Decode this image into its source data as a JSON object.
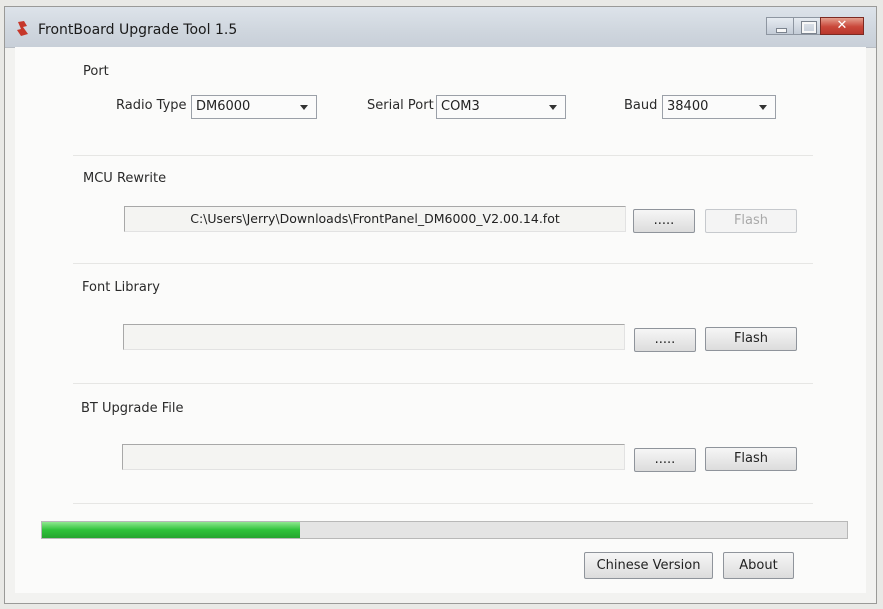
{
  "window": {
    "title": "FrontBoard Upgrade Tool 1.5",
    "controls": {
      "minimize_icon": "minimize-icon",
      "maximize_icon": "maximize-icon",
      "close_label": "✕"
    }
  },
  "port": {
    "section_label": "Port",
    "radio_type_label": "Radio Type",
    "radio_type_value": "DM6000",
    "serial_port_label": "Serial Port",
    "serial_port_value": "COM3",
    "baud_label": "Baud",
    "baud_value": "38400"
  },
  "mcu": {
    "section_label": "MCU Rewrite",
    "path": "C:\\Users\\Jerry\\Downloads\\FrontPanel_DM6000_V2.00.14.fot",
    "browse_label": ".....",
    "flash_label": "Flash",
    "flash_enabled": false
  },
  "font": {
    "section_label": "Font Library",
    "path": "",
    "browse_label": ".....",
    "flash_label": "Flash"
  },
  "bt": {
    "section_label": "BT Upgrade File",
    "path": "",
    "browse_label": ".....",
    "flash_label": "Flash"
  },
  "progress": {
    "value": 0.32,
    "color": "#2fc23a"
  },
  "footer": {
    "chinese_label": "Chinese Version",
    "about_label": "About"
  },
  "colors": {
    "title_bar": "#cfd6de",
    "close_button": "#c9473a",
    "accent_progress": "#2fc23a"
  }
}
